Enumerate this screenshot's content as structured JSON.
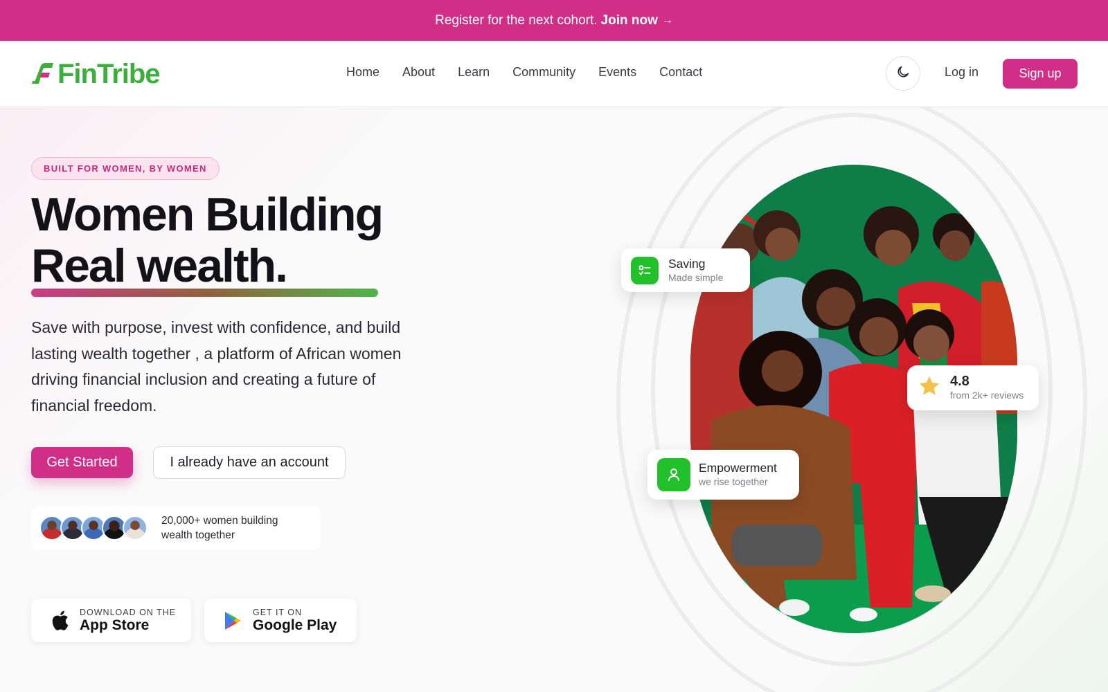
{
  "announcement": {
    "text": "Register for the next cohort.",
    "cta": "Join now",
    "arrow": "→"
  },
  "nav": {
    "logo_text": "FinTribe",
    "links": [
      "Home",
      "About",
      "Learn",
      "Community",
      "Events",
      "Contact"
    ],
    "theme_icon": "moon-icon",
    "login": "Log in",
    "signup": "Sign up"
  },
  "hero": {
    "badge": "BUILT FOR WOMEN, BY WOMEN",
    "headline_line1": "Women Building",
    "headline_line2": "Real wealth.",
    "description": "Save with purpose, invest with confidence, and build lasting wealth together , a platform of African women driving financial inclusion and creating a future of financial freedom.",
    "primary_cta": "Get Started",
    "secondary_cta": "I already have an account",
    "social_proof": "20,000+ women building wealth together",
    "app_store": {
      "small": "DOWNLOAD ON THE",
      "big": "App Store",
      "icon": "apple-icon"
    },
    "google_play": {
      "small": "GET IT ON",
      "big": "Google Play",
      "icon": "google-play-icon"
    }
  },
  "cards": {
    "saving": {
      "title": "Saving",
      "subtitle": "Made simple",
      "icon": "checklist-icon"
    },
    "rating": {
      "value": "4.8",
      "subtitle": "from 2k+ reviews",
      "icon": "star-icon"
    },
    "empowerment": {
      "title": "Empowerment",
      "subtitle": "we rise together",
      "icon": "person-icon"
    }
  },
  "colors": {
    "brand_pink": "#d12f87",
    "brand_green": "#3cae3b",
    "icon_green": "#22c02a",
    "photo_background": "#0f7d47"
  }
}
